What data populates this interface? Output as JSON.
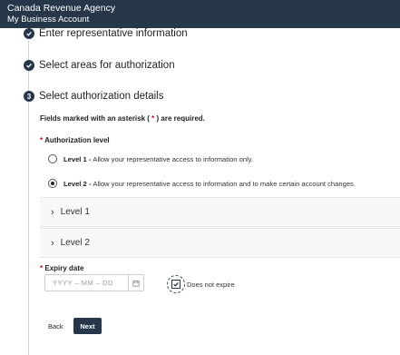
{
  "header": {
    "agency": "Canada Revenue Agency",
    "account": "My Business Account",
    "background_color": "#26374a"
  },
  "steps": [
    {
      "number": "",
      "status": "complete",
      "icon": "check-icon",
      "title": "Enter representative information"
    },
    {
      "number": "",
      "status": "complete",
      "icon": "check-icon",
      "title": "Select areas for authorization"
    },
    {
      "number": "3",
      "status": "current",
      "title": "Select authorization details"
    }
  ],
  "form": {
    "required_note": {
      "before": "Fields marked with an asterisk (",
      "star": "*",
      "after": ") are required."
    },
    "authorization_level": {
      "star": "*",
      "label": "Authorization level",
      "options": [
        {
          "title": "Level 1 -",
          "description": "Allow your representative access to information only.",
          "selected": false
        },
        {
          "title": "Level 2 -",
          "description": "Allow your representative access to information and to make certain account changes.",
          "selected": true
        }
      ]
    },
    "accordions": [
      {
        "label": "Level 1",
        "expanded": false
      },
      {
        "label": "Level 2",
        "expanded": false
      }
    ],
    "expiry": {
      "star": "*",
      "label": "Expiry date",
      "placeholder": "YYYY  –  MM  –  DD",
      "does_not_expire_label": "Does not expire",
      "does_not_expire_checked": true
    }
  },
  "buttons": {
    "back": "Back",
    "next": "Next"
  },
  "colors": {
    "primary": "#26374a",
    "required": "#d3080c"
  }
}
